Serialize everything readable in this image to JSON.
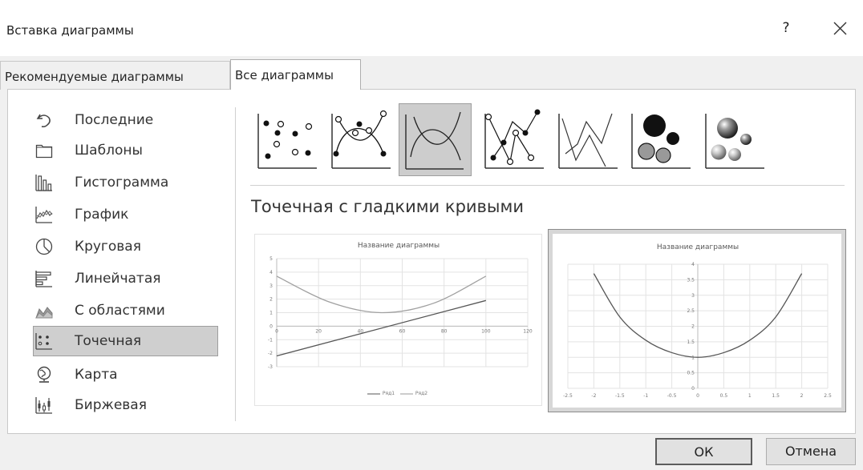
{
  "window": {
    "title": "Вставка диаграммы",
    "help": "?"
  },
  "tabs": [
    {
      "label": "Рекомендуемые диаграммы",
      "active": false
    },
    {
      "label": "Все диаграммы",
      "active": true
    }
  ],
  "sidebar": {
    "items": [
      {
        "label": "Последние",
        "icon": "recent-icon"
      },
      {
        "label": "Шаблоны",
        "icon": "folder-icon"
      },
      {
        "label": "Гистограмма",
        "icon": "column-chart-icon"
      },
      {
        "label": "График",
        "icon": "line-chart-icon"
      },
      {
        "label": "Круговая",
        "icon": "pie-chart-icon"
      },
      {
        "label": "Линейчатая",
        "icon": "bar-chart-icon"
      },
      {
        "label": "С областями",
        "icon": "area-chart-icon"
      },
      {
        "label": "Точечная",
        "icon": "scatter-chart-icon",
        "selected": true
      },
      {
        "label": "Карта",
        "icon": "map-icon"
      },
      {
        "label": "Биржевая",
        "icon": "stock-chart-icon"
      }
    ]
  },
  "subtypes": [
    {
      "icon": "scatter-markers-icon"
    },
    {
      "icon": "scatter-smooth-markers-icon"
    },
    {
      "icon": "scatter-smooth-lines-icon",
      "selected": true
    },
    {
      "icon": "scatter-straight-markers-icon"
    },
    {
      "icon": "scatter-straight-lines-icon"
    },
    {
      "icon": "bubble-icon"
    },
    {
      "icon": "bubble-3d-icon"
    }
  ],
  "section_title": "Точечная с гладкими кривыми",
  "previews": [
    {
      "title": "Название диаграммы",
      "y_ticks": [
        "5",
        "4",
        "3",
        "2",
        "1",
        "0",
        "-1",
        "-2",
        "-3"
      ],
      "x_ticks": [
        "0",
        "20",
        "40",
        "60",
        "80",
        "100",
        "120"
      ],
      "legend": [
        "Ряд1",
        "Ряд2"
      ]
    },
    {
      "title": "Название диаграммы",
      "y_ticks": [
        "4",
        "3.5",
        "3",
        "2.5",
        "2",
        "1.5",
        "1",
        "0.5",
        "0"
      ],
      "x_ticks": [
        "-2.5",
        "-2",
        "-1.5",
        "-1",
        "-0.5",
        "0",
        "0.5",
        "1",
        "1.5",
        "2",
        "2.5"
      ],
      "selected": true
    }
  ],
  "chart_data": [
    {
      "type": "line",
      "title": "Название диаграммы",
      "xlim": [
        0,
        120
      ],
      "ylim": [
        -3,
        5
      ],
      "series": [
        {
          "name": "Ряд1",
          "x": [
            0,
            100
          ],
          "y": [
            -2.2,
            1.9
          ]
        },
        {
          "name": "Ряд2",
          "x": [
            0,
            25,
            50,
            75,
            100
          ],
          "y": [
            3.7,
            1.8,
            1.0,
            1.7,
            3.7
          ]
        }
      ]
    },
    {
      "type": "line",
      "title": "Название диаграммы",
      "xlim": [
        -2.5,
        2.5
      ],
      "ylim": [
        0,
        4
      ],
      "series": [
        {
          "x": [
            -2,
            -1.5,
            -1,
            -0.5,
            0,
            0.5,
            1,
            1.5,
            2
          ],
          "y": [
            3.7,
            2.3,
            1.55,
            1.15,
            1.0,
            1.15,
            1.55,
            2.3,
            3.7
          ]
        }
      ]
    }
  ],
  "buttons": {
    "ok": "ОК",
    "cancel": "Отмена"
  }
}
